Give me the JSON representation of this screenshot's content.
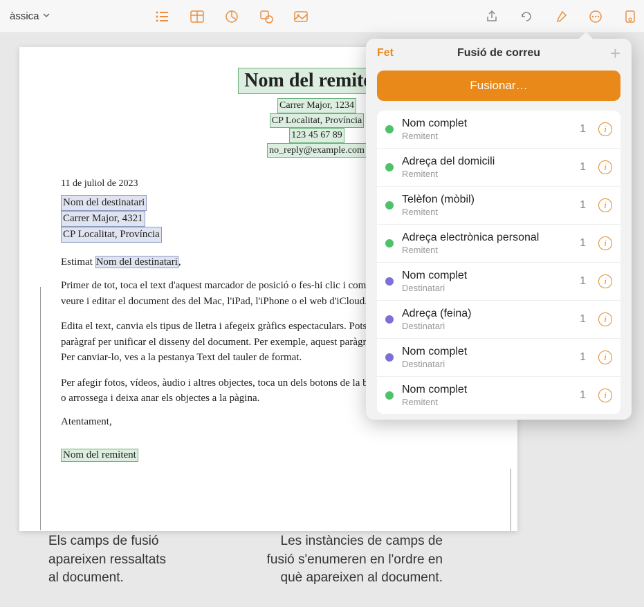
{
  "toolbar": {
    "style_label": "àssica"
  },
  "document": {
    "sender_name": "Nom del remitent",
    "sender_street": "Carrer Major, 1234",
    "sender_city": "CP Localitat, Província",
    "sender_phone": "123 45 67 89",
    "sender_email": "no_reply@example.com",
    "date": "11 de juliol de 2023",
    "recipient_name": "Nom del destinatari",
    "recipient_street": "Carrer Major, 4321",
    "recipient_city": "CP Localitat, Província",
    "salutation_prefix": "Estimat ",
    "salutation_name": "Nom del destinatari",
    "salutation_suffix": ",",
    "p1": "Primer de tot, toca el text d'aquest marcador de posició o fes-hi clic i comença a escriure. Pots veure i editar el document des del Mac, l'iPad, l'iPhone o el web d'iCloud.com.",
    "p2": "Edita el text, canvia els tipus de lletra i afegeix gràfics espectaculars. Pots fer servir estils de paràgraf per unificar el disseny del document. Per exemple, aquest paràgraf utilitza l'estil \"Cos\". Per canviar-lo, ves a la pestanya Text del tauler de format.",
    "p3": "Per afegir fotos, vídeos, àudio i altres objectes, toca un dels botons de la barra d'eines o fes-hi clic, o arrossega i deixa anar els objectes a la pàgina.",
    "closing": "Atentament,",
    "sender_footer": "Nom del remitent"
  },
  "popover": {
    "done": "Fet",
    "title": "Fusió de correu",
    "merge_button": "Fusionar…",
    "fields": [
      {
        "name": "Nom complet",
        "sub": "Remitent",
        "color": "green",
        "count": "1"
      },
      {
        "name": "Adreça del domicili",
        "sub": "Remitent",
        "color": "green",
        "count": "1"
      },
      {
        "name": "Telèfon (mòbil)",
        "sub": "Remitent",
        "color": "green",
        "count": "1"
      },
      {
        "name": "Adreça electrònica personal",
        "sub": "Remitent",
        "color": "green",
        "count": "1"
      },
      {
        "name": "Nom complet",
        "sub": "Destinatari",
        "color": "blue",
        "count": "1"
      },
      {
        "name": "Adreça (feina)",
        "sub": "Destinatari",
        "color": "blue",
        "count": "1"
      },
      {
        "name": "Nom complet",
        "sub": "Destinatari",
        "color": "blue",
        "count": "1"
      },
      {
        "name": "Nom complet",
        "sub": "Remitent",
        "color": "green",
        "count": "1"
      }
    ]
  },
  "callouts": {
    "left": "Els camps de fusió apareixen ressaltats al document.",
    "right": "Les instàncies de camps de fusió s'enumeren en l'ordre en què apareixen al document."
  }
}
